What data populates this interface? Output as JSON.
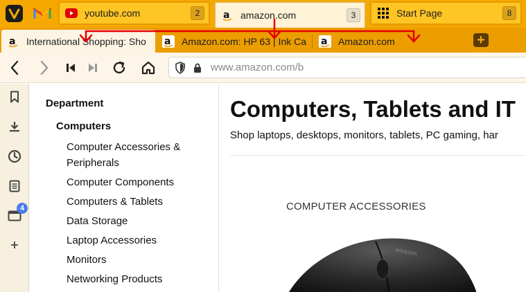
{
  "stack_tabs": [
    {
      "label": "youtube.com",
      "count": "2",
      "icon": "youtube-icon"
    },
    {
      "label": "amazon.com",
      "count": "3",
      "icon": "amazon-icon"
    },
    {
      "label": "Start Page",
      "count": "8",
      "icon": "grid-icon"
    }
  ],
  "sub_tabs": [
    {
      "label": "International Shopping: Sho",
      "icon": "amazon-icon"
    },
    {
      "label": "Amazon.com: HP 63 | Ink Ca",
      "icon": "amazon-icon"
    },
    {
      "label": "Amazon.com",
      "icon": "amazon-icon"
    }
  ],
  "address": {
    "url": "www.amazon.com/b"
  },
  "side_panel": {
    "tabs_badge": "4"
  },
  "department": {
    "heading": "Department",
    "selected": "Computers",
    "items": [
      "Computer Accessories & Peripherals",
      "Computer Components",
      "Computers & Tablets",
      "Data Storage",
      "Laptop Accessories",
      "Monitors",
      "Networking Products"
    ]
  },
  "main": {
    "title": "Computers, Tablets and IT",
    "subtitle": "Shop laptops, desktops, monitors, tablets, PC gaming, har",
    "section_label": "COMPUTER ACCESSORIES"
  },
  "colors": {
    "accent": "#f5a800",
    "annotation_arrows": "#e60000"
  }
}
